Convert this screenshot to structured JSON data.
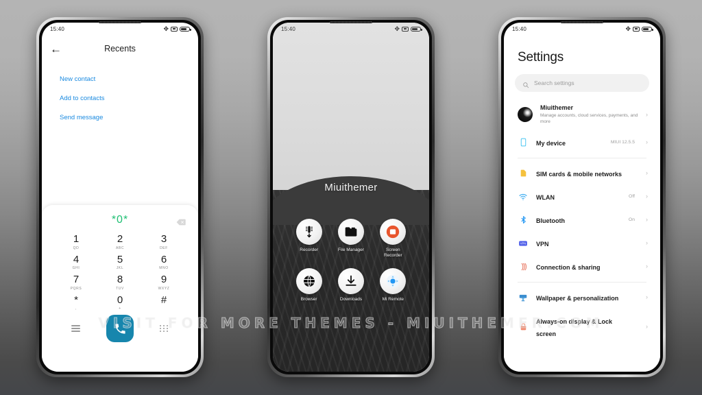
{
  "watermark": "VISIT FOR MORE THEMES - MIUITHEMER.COM",
  "colors": {
    "accent_blue": "#1a8ae0",
    "dial_green": "#1fbf73",
    "call_button": "#1786ad",
    "bluetooth_blue": "#2196f3",
    "recorder_orange": "#e8552d"
  },
  "status_bar": {
    "time": "15:40",
    "icons": [
      "bluetooth-icon",
      "dnd-icon",
      "battery-icon"
    ]
  },
  "phone1": {
    "name": "dialer-phone",
    "header": {
      "back_icon": "back-arrow-icon",
      "title": "Recents"
    },
    "links": [
      {
        "label": "New contact"
      },
      {
        "label": "Add to contacts"
      },
      {
        "label": "Send message"
      }
    ],
    "dialpad": {
      "display": "*0*",
      "backspace_icon": "backspace-icon",
      "keys": [
        {
          "digit": "1",
          "letters": "QD"
        },
        {
          "digit": "2",
          "letters": "ABC"
        },
        {
          "digit": "3",
          "letters": "DEF"
        },
        {
          "digit": "4",
          "letters": "GHI"
        },
        {
          "digit": "5",
          "letters": "JKL"
        },
        {
          "digit": "6",
          "letters": "MNO"
        },
        {
          "digit": "7",
          "letters": "PQRS"
        },
        {
          "digit": "8",
          "letters": "TUV"
        },
        {
          "digit": "9",
          "letters": "WXYZ"
        },
        {
          "digit": "*",
          "letters": ","
        },
        {
          "digit": "0",
          "letters": "+"
        },
        {
          "digit": "#",
          "letters": ""
        }
      ],
      "bottom": {
        "menu_icon": "menu-icon",
        "call_icon": "phone-call-icon",
        "keyboard_icon": "keypad-icon"
      }
    }
  },
  "phone2": {
    "name": "home-screen-phone",
    "wallpaper_title": "Miuithemer",
    "apps": [
      {
        "label": "Recorder",
        "icon": "recorder-icon"
      },
      {
        "label": "File Manager",
        "icon": "folder-icon"
      },
      {
        "label": "Screen Recorder",
        "icon": "screen-recorder-icon"
      },
      {
        "label": "Browser",
        "icon": "globe-icon"
      },
      {
        "label": "Downloads",
        "icon": "download-icon"
      },
      {
        "label": "Mi Remote",
        "icon": "remote-dpad-icon"
      }
    ]
  },
  "phone3": {
    "name": "settings-phone",
    "title": "Settings",
    "search": {
      "placeholder": "Search settings",
      "icon": "search-icon"
    },
    "account": {
      "name": "Miuithemer",
      "subtitle": "Manage accounts, cloud services, payments, and more",
      "avatar": "account-avatar"
    },
    "items": [
      {
        "label": "My device",
        "value": "MIUI 12.5.5",
        "icon": "device-icon"
      },
      {
        "label": "SIM cards & mobile networks",
        "value": "",
        "icon": "sim-card-icon"
      },
      {
        "label": "WLAN",
        "value": "Off",
        "icon": "wifi-icon"
      },
      {
        "label": "Bluetooth",
        "value": "On",
        "icon": "bluetooth-icon"
      },
      {
        "label": "VPN",
        "value": "",
        "icon": "vpn-icon"
      },
      {
        "label": "Connection & sharing",
        "value": "",
        "icon": "connection-sharing-icon"
      },
      {
        "label": "Wallpaper & personalization",
        "value": "",
        "icon": "wallpaper-icon"
      },
      {
        "label": "Always-on display & Lock screen",
        "value": "",
        "icon": "lock-icon"
      }
    ]
  }
}
